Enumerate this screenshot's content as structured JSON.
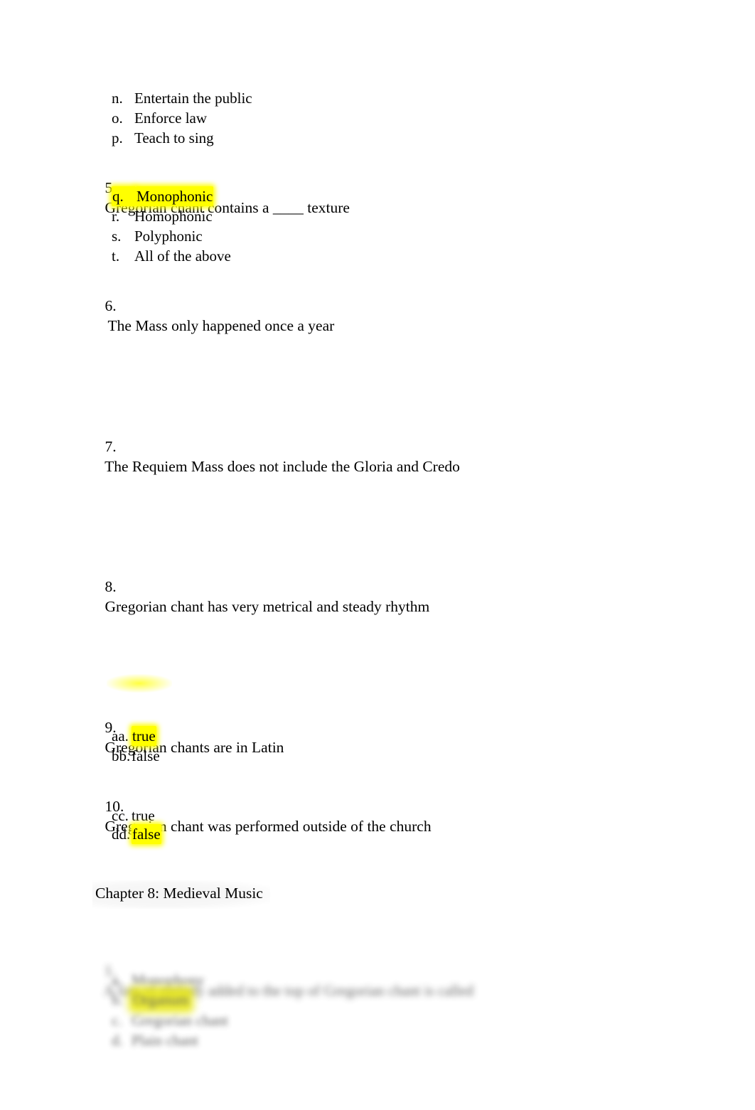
{
  "document": {
    "page_background": "#ffffff",
    "highlight_color": "#ffff00",
    "text_color": "#000000"
  },
  "carryover_options": {
    "items": [
      {
        "marker": "n.",
        "text": "Entertain the public",
        "highlighted": false
      },
      {
        "marker": "o.",
        "text": "Enforce law",
        "highlighted": false
      },
      {
        "marker": "p.",
        "text": "Teach to sing",
        "highlighted": false
      }
    ]
  },
  "questions": [
    {
      "number": "5.",
      "text": "Gregorian chant contains a ____ texture",
      "options": [
        {
          "marker": "q.",
          "text": "Monophonic",
          "highlighted": true
        },
        {
          "marker": "r.",
          "text": "Homophonic",
          "highlighted": false
        },
        {
          "marker": "s.",
          "text": "Polyphonic",
          "highlighted": false
        },
        {
          "marker": "t.",
          "text": "All of the above",
          "highlighted": false
        }
      ]
    },
    {
      "number": "6.",
      "text": "The Mass only happened once a year",
      "options": []
    },
    {
      "number": "7.",
      "text": "The Requiem Mass does not include the Gloria and Credo",
      "options": []
    },
    {
      "number": "8.",
      "text": "Gregorian chant has very metrical and steady rhythm",
      "options": []
    },
    {
      "number": "9.",
      "text": "Gregorian chants are in Latin",
      "options": [
        {
          "marker": "aa.",
          "text": "true",
          "highlighted": true
        },
        {
          "marker": "bb.",
          "text": "false",
          "highlighted": false
        }
      ]
    },
    {
      "number": "10.",
      "text": "Gregorian chant was performed outside of the church",
      "options": [
        {
          "marker": "cc.",
          "text": "true",
          "highlighted": false
        },
        {
          "marker": "dd.",
          "text": "false",
          "highlighted": true
        }
      ]
    }
  ],
  "chapter_heading": {
    "text": "Chapter 8: Medieval Music"
  },
  "redacted_section": {
    "note": "blurred / illegible",
    "question": {
      "number": "1.",
      "text": "A line of melody added to the top of Gregorian chant is called"
    },
    "options": [
      {
        "marker": "a.",
        "text": "Monophony",
        "highlighted": false
      },
      {
        "marker": "b.",
        "text": "Organum",
        "highlighted": true
      },
      {
        "marker": "c.",
        "text": "Gregorian chant",
        "highlighted": false
      },
      {
        "marker": "d.",
        "text": "Plain chant",
        "highlighted": false
      }
    ]
  }
}
